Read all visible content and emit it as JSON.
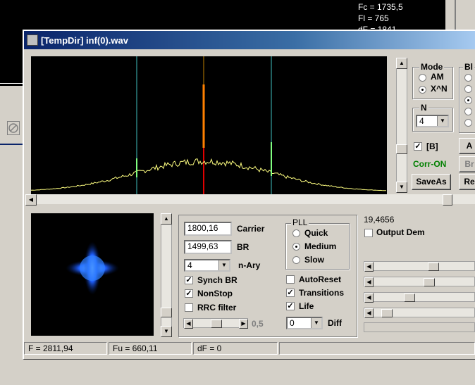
{
  "background": {
    "readout": [
      "Fc = 1735,5",
      "Fl = 765",
      "dF = 1841"
    ]
  },
  "window": {
    "title": "[TempDir] inf(0).wav"
  },
  "mode": {
    "label": "Mode",
    "options": [
      "AM",
      "X^N"
    ],
    "selected": "X^N"
  },
  "n": {
    "label": "N",
    "value": "4"
  },
  "block": {
    "label": "Bl"
  },
  "b_check": {
    "label": "[B]",
    "checked": true
  },
  "corr_label": "Corr-ON",
  "corr_color": "#008000",
  "save_as": "SaveAs",
  "right_buttons": [
    "A",
    "Br",
    "Re"
  ],
  "carrier": {
    "value": "1800,16",
    "label": "Carrier"
  },
  "br": {
    "value": "1499,63",
    "label": "BR"
  },
  "n_ary": {
    "value": "4",
    "label": "n-Ary"
  },
  "checks_left": [
    {
      "label": "Synch BR",
      "checked": true
    },
    {
      "label": "NonStop",
      "checked": true
    },
    {
      "label": "RRC filter",
      "checked": false
    }
  ],
  "slider_value": "0,5",
  "pll": {
    "label": "PLL",
    "options": [
      "Quick",
      "Medium",
      "Slow"
    ],
    "selected": "Medium"
  },
  "checks_mid": [
    {
      "label": "AutoReset",
      "checked": false
    },
    {
      "label": "Transitions",
      "checked": true
    },
    {
      "label": "Life",
      "checked": true
    }
  ],
  "diff": {
    "value": "0",
    "label": "Diff"
  },
  "readout_value": "19,4656",
  "output_dem": {
    "label": "Output Dem",
    "checked": false
  },
  "status": {
    "f": "F = 2811,94",
    "fu": "Fu = 660,11",
    "df": "dF = 0"
  },
  "spectrum": {
    "trace_color": "#ffff80",
    "marker_color": "#40c0c0",
    "center_color": "#ff8000"
  },
  "constellation": {
    "color": "#2060ff"
  }
}
